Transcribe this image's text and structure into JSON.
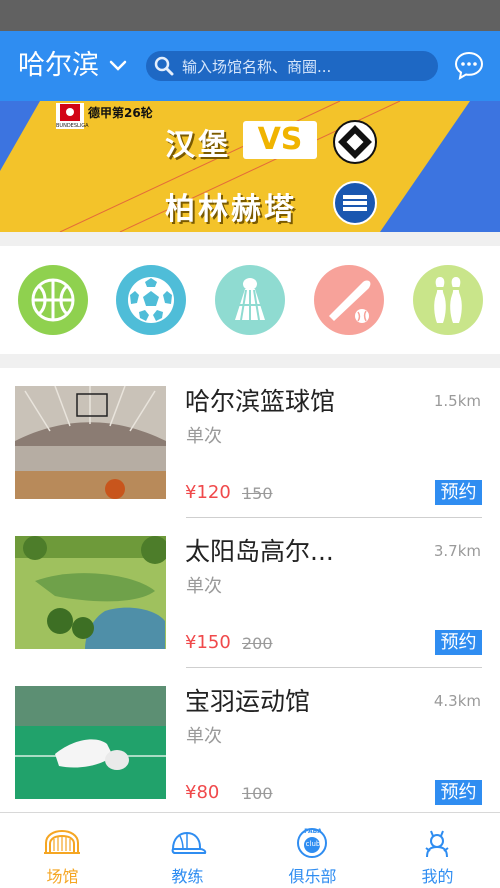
{
  "header": {
    "city": "哈尔滨",
    "search_placeholder": "输入场馆名称、商圈..."
  },
  "banner": {
    "league": "BUNDESLIGA",
    "round": "德甲第26轮",
    "team1": "汉堡",
    "vs": "VS",
    "team2": "柏林赫塔"
  },
  "categories": [
    {
      "icon": "basketball-icon",
      "color": "#8fd14f"
    },
    {
      "icon": "football-icon",
      "color": "#4fbdd8"
    },
    {
      "icon": "badminton-icon",
      "color": "#8fdbd1"
    },
    {
      "icon": "baseball-icon",
      "color": "#f7a29a"
    },
    {
      "icon": "bowling-icon",
      "color": "#c9e58a"
    }
  ],
  "venues": [
    {
      "name": "哈尔滨篮球馆",
      "distance": "1.5km",
      "type": "单次",
      "price": "¥120",
      "original_price": "150",
      "book_label": "预约"
    },
    {
      "name": "太阳岛高尔...",
      "distance": "3.7km",
      "type": "单次",
      "price": "¥150",
      "original_price": "200",
      "book_label": "预约"
    },
    {
      "name": "宝羽运动馆",
      "distance": "4.3km",
      "type": "单次",
      "price": "¥80",
      "original_price": "100",
      "book_label": "预约"
    }
  ],
  "tabs": [
    {
      "label": "场馆",
      "icon": "stadium-icon",
      "active": true
    },
    {
      "label": "教练",
      "icon": "cap-icon",
      "active": false
    },
    {
      "label": "俱乐部",
      "icon": "club-badge-icon",
      "badge_text_top": "PABA",
      "badge_text": "club",
      "active": false
    },
    {
      "label": "我的",
      "icon": "profile-icon",
      "active": false
    }
  ],
  "colors": {
    "brand": "#2f8df1",
    "active_tab": "#f5a623",
    "price": "#f0494b"
  }
}
